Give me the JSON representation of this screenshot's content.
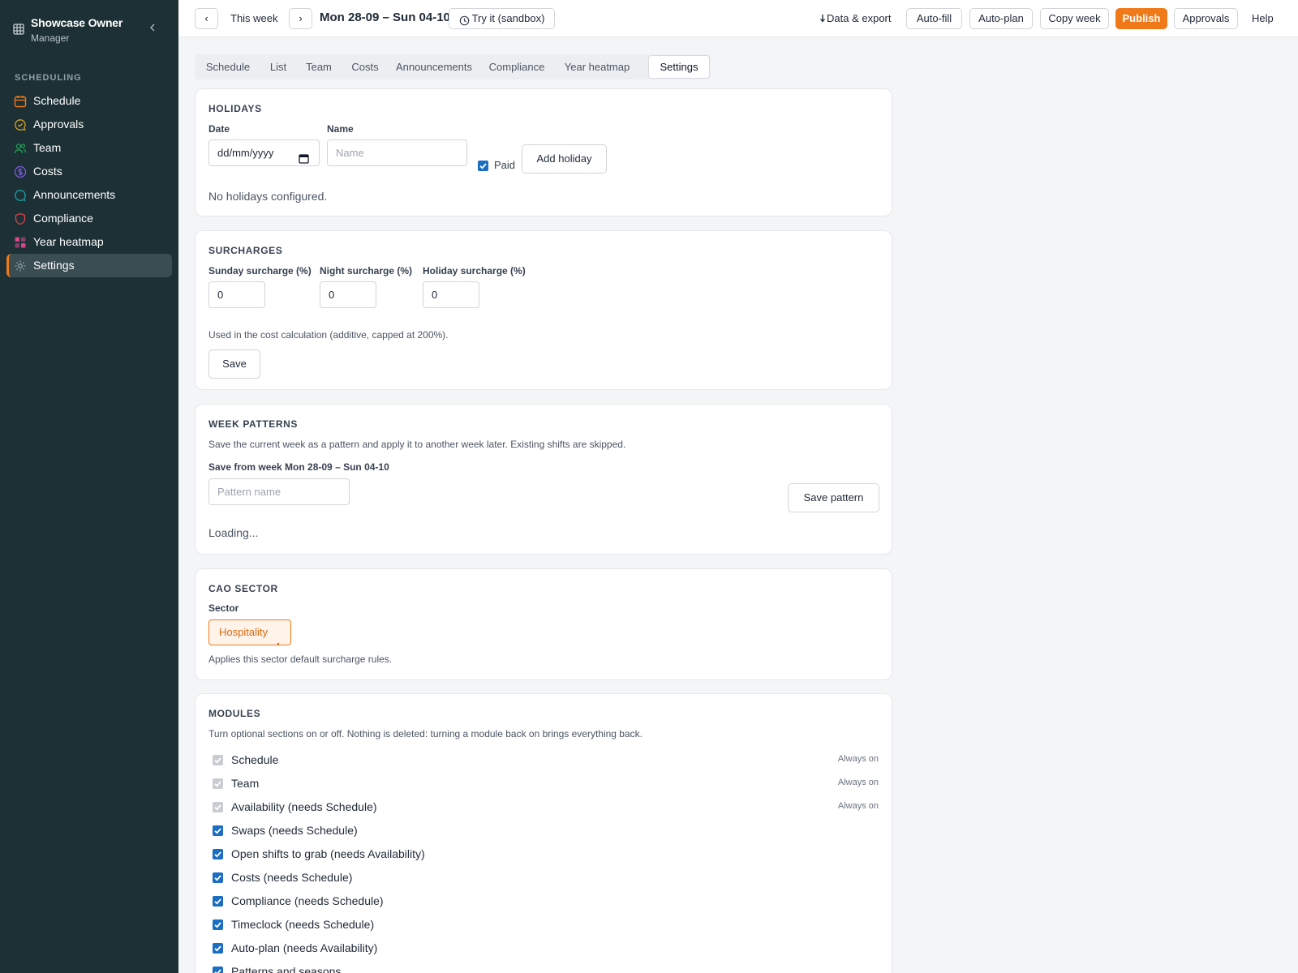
{
  "sidebar": {
    "owner_name": "Showcase Owner",
    "owner_role": "Manager",
    "section_label": "SCHEDULING",
    "items": [
      {
        "label": "Schedule",
        "icon": "calendar-icon",
        "color": "#f07a1a"
      },
      {
        "label": "Approvals",
        "icon": "chat-check-icon",
        "color": "#d9a01a"
      },
      {
        "label": "Team",
        "icon": "users-icon",
        "color": "#22a356"
      },
      {
        "label": "Costs",
        "icon": "dollar-icon",
        "color": "#7c5ce0"
      },
      {
        "label": "Announcements",
        "icon": "message-icon",
        "color": "#16a4a4"
      },
      {
        "label": "Compliance",
        "icon": "shield-icon",
        "color": "#e0414c"
      },
      {
        "label": "Year heatmap",
        "icon": "heatmap-icon",
        "color": "#d94389"
      },
      {
        "label": "Settings",
        "icon": "gear-icon",
        "color": "#8fa1a4"
      }
    ]
  },
  "topbar": {
    "prev_label": "‹",
    "this_week": "This week",
    "next_label": "›",
    "range": "Mon 28-09 – Sun 04-10",
    "sandbox": "Try it (sandbox)",
    "data_export": "Data & export",
    "autofill": "Auto-fill",
    "autoplan": "Auto-plan",
    "copy_week": "Copy week",
    "publish": "Publish",
    "approvals": "Approvals",
    "help": "Help"
  },
  "tabs": [
    "Schedule",
    "List",
    "Team",
    "Costs",
    "Announcements",
    "Compliance",
    "Year heatmap",
    "Settings"
  ],
  "holidays": {
    "title": "HOLIDAYS",
    "date_label": "Date",
    "date_value": "dd/mm/yyyy",
    "name_label": "Name",
    "name_placeholder": "Name",
    "paid_label": "Paid",
    "add_button": "Add holiday",
    "empty": "No holidays configured."
  },
  "surcharges": {
    "title": "SURCHARGES",
    "sunday_label": "Sunday surcharge (%)",
    "sunday_value": "0",
    "night_label": "Night surcharge (%)",
    "night_value": "0",
    "holiday_label": "Holiday surcharge (%)",
    "holiday_value": "0",
    "note": "Used in the cost calculation (additive, capped at 200%).",
    "save": "Save"
  },
  "patterns": {
    "title": "WEEK PATTERNS",
    "desc": "Save the current week as a pattern and apply it to another week later. Existing shifts are skipped.",
    "save_from": "Save from week Mon 28-09 – Sun 04-10",
    "name_placeholder": "Pattern name",
    "save_button": "Save pattern",
    "loading": "Loading..."
  },
  "cao": {
    "title": "CAO SECTOR",
    "sector_label": "Sector",
    "sector_value": "Hospitality",
    "note": "Applies this sector default surcharge rules."
  },
  "modules": {
    "title": "MODULES",
    "desc": "Turn optional sections on or off. Nothing is deleted: turning a module back on brings everything back.",
    "always_on": "Always on",
    "items": [
      {
        "label": "Schedule",
        "checked": true,
        "locked": true
      },
      {
        "label": "Team",
        "checked": true,
        "locked": true
      },
      {
        "label": "Availability (needs Schedule)",
        "checked": true,
        "locked": true
      },
      {
        "label": "Swaps (needs Schedule)",
        "checked": true,
        "locked": false
      },
      {
        "label": "Open shifts to grab (needs Availability)",
        "checked": true,
        "locked": false
      },
      {
        "label": "Costs (needs Schedule)",
        "checked": true,
        "locked": false
      },
      {
        "label": "Compliance (needs Schedule)",
        "checked": true,
        "locked": false
      },
      {
        "label": "Timeclock (needs Schedule)",
        "checked": true,
        "locked": false
      },
      {
        "label": "Auto-plan (needs Availability)",
        "checked": true,
        "locked": false
      },
      {
        "label": "Patterns and seasons",
        "checked": true,
        "locked": false
      }
    ]
  },
  "colors": {
    "accent": "#f07a1a",
    "sidebar_bg": "#1d3035",
    "checkbox": "#1b6ec2"
  }
}
